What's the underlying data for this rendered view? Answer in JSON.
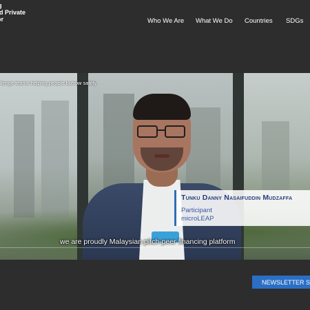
{
  "logo": {
    "line1": "g",
    "line2": "d Private",
    "line3": "or"
  },
  "nav": {
    "items": [
      "Who We Are",
      "What We Do",
      "Countries",
      "SDGs"
    ]
  },
  "video": {
    "top_caption": "llenge teams helping people borrow safely",
    "lower_third": {
      "name": "Tunku Danny Nasaifuddin Mudzaffa",
      "role": "Participant",
      "organization": "microLEAP"
    },
    "subtitle": "we are proudly Malaysian pitch-peer financing platform"
  },
  "newsletter_button": "NEWSLETTER SIG",
  "colors": {
    "background": "#2d2d2d",
    "accent_blue": "#2a6fc4",
    "name_color": "#2a3f7c"
  }
}
